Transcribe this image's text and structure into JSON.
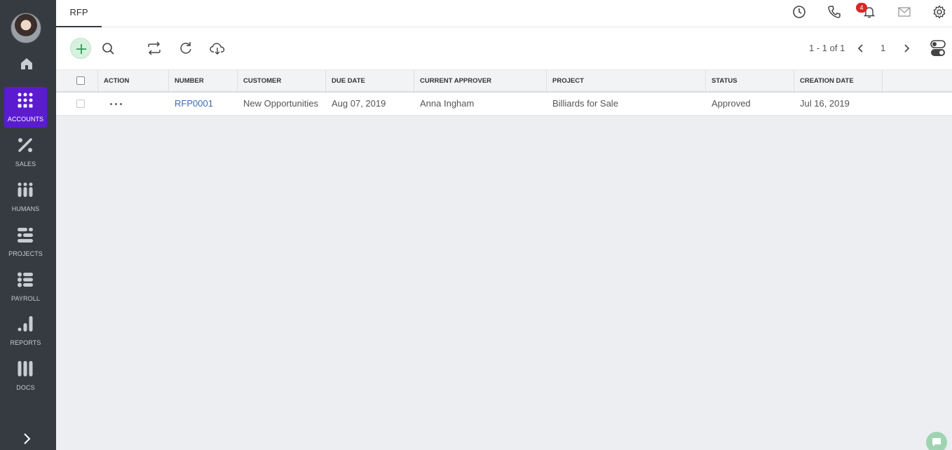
{
  "sidebar": {
    "items": [
      {
        "label": "ACCOUNTS",
        "icon": "grid-dots-icon",
        "active": true
      },
      {
        "label": "SALES",
        "icon": "percent-icon"
      },
      {
        "label": "HUMANS",
        "icon": "people-icon"
      },
      {
        "label": "PROJECTS",
        "icon": "projects-icon"
      },
      {
        "label": "PAYROLL",
        "icon": "payroll-icon"
      },
      {
        "label": "REPORTS",
        "icon": "bar-chart-icon"
      },
      {
        "label": "DOCS",
        "icon": "docs-icon"
      }
    ]
  },
  "header": {
    "tab_label": "RFP",
    "notification_count": "4"
  },
  "toolbar": {
    "pager_text": "1 - 1 of 1",
    "page_number": "1"
  },
  "table": {
    "columns": [
      "ACTION",
      "NUMBER",
      "CUSTOMER",
      "DUE DATE",
      "CURRENT APPROVER",
      "PROJECT",
      "STATUS",
      "CREATION DATE"
    ],
    "rows": [
      {
        "number": "RFP0001",
        "customer": "New Opportunities",
        "due_date": "Aug 07, 2019",
        "approver": "Anna Ingham",
        "project": "Billiards for Sale",
        "status": "Approved",
        "creation_date": "Jul 16, 2019"
      }
    ]
  },
  "colors": {
    "sidebar_bg": "#363b41",
    "active_nav": "#5b1bd1",
    "link": "#3b6db3",
    "badge": "#d92727"
  }
}
